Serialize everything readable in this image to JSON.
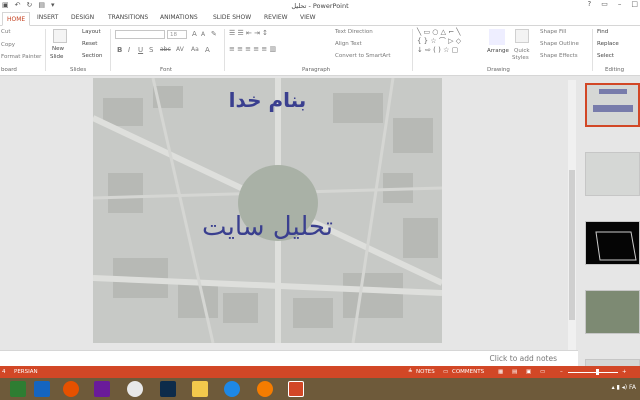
{
  "window": {
    "title": "تحلیل - PowerPoint"
  },
  "tabs": [
    {
      "label": "HOME",
      "active": true
    },
    {
      "label": "INSERT"
    },
    {
      "label": "DESIGN"
    },
    {
      "label": "TRANSITIONS"
    },
    {
      "label": "ANIMATIONS"
    },
    {
      "label": "SLIDE SHOW"
    },
    {
      "label": "REVIEW"
    },
    {
      "label": "VIEW"
    }
  ],
  "ribbon": {
    "clipboard": {
      "cut": "Cut",
      "copy": "Copy",
      "format_painter": "Format Painter",
      "label": "board"
    },
    "slides": {
      "new_slide": "New",
      "new_slide2": "Slide",
      "layout": "Layout",
      "reset": "Reset",
      "section": "Section",
      "label": "Slides"
    },
    "font": {
      "font_size": "18",
      "label": "Font"
    },
    "paragraph": {
      "text_direction": "Text Direction",
      "align_text": "Align Text",
      "convert": "Convert to SmartArt",
      "label": "Paragraph"
    },
    "drawing": {
      "arrange": "Arrange",
      "quick_styles": "Quick",
      "quick_styles2": "Styles",
      "shape_fill": "Shape Fill",
      "shape_outline": "Shape Outline",
      "shape_effects": "Shape Effects",
      "label": "Drawing"
    },
    "editing": {
      "find": "Find",
      "replace": "Replace",
      "select": "Select",
      "label": "Editing"
    }
  },
  "slide": {
    "title": "بنام خدا",
    "subtitle": "تحلیل سایت"
  },
  "notes": {
    "placeholder": "Click to add notes"
  },
  "status": {
    "slide_num": "4",
    "language": "PERSIAN",
    "notes": "NOTES",
    "comments": "COMMENTS"
  },
  "tray": {
    "lang": "FA"
  },
  "colors": {
    "accent": "#d24726",
    "title_text": "#3a3f8f"
  }
}
